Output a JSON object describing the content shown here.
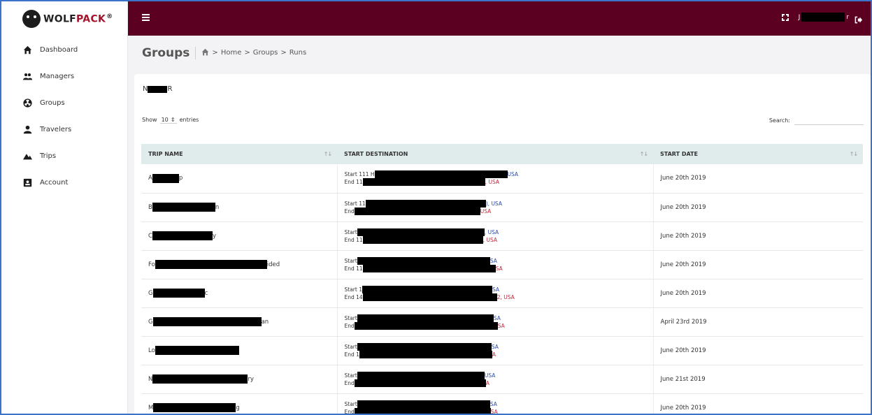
{
  "brand": {
    "name_part1": "WOLF",
    "name_part2": "PACK",
    "registered": "®"
  },
  "sidebar": {
    "items": [
      {
        "label": "Dashboard",
        "icon": "home-icon"
      },
      {
        "label": "Managers",
        "icon": "users-icon"
      },
      {
        "label": "Groups",
        "icon": "radiation-icon"
      },
      {
        "label": "Travelers",
        "icon": "user-icon"
      },
      {
        "label": "Trips",
        "icon": "mountains-icon"
      },
      {
        "label": "Account",
        "icon": "id-card-icon"
      }
    ]
  },
  "topbar": {
    "user_prefix": "J",
    "user_suffix": "r"
  },
  "breadcrumb": {
    "title": "Groups",
    "items": [
      "Home",
      "Groups",
      "Runs"
    ],
    "separator": ">"
  },
  "group": {
    "name_prefix": "N",
    "name_suffix": "R"
  },
  "table_controls": {
    "show_label": "Show",
    "entries_value": "10",
    "entries_label": "entries",
    "search_label": "Search:"
  },
  "table": {
    "headers": [
      "TRIP NAME",
      "START DESTINATION",
      "START DATE"
    ],
    "rows": [
      {
        "name_pre": "A",
        "name_post": "p",
        "start_pre": "Start 111 H",
        "start_post": "USA",
        "end_pre": "End 11",
        "end_post": ", USA",
        "date": "June 20th 2019"
      },
      {
        "name_pre": "B",
        "name_post": "n",
        "start_pre": "Start 11",
        "start_post": "), USA",
        "end_pre": "End",
        "end_post": "USA",
        "date": "June 20th 2019"
      },
      {
        "name_pre": "C",
        "name_post": "y",
        "start_pre": "Start",
        "start_post": ", USA",
        "end_pre": "End 11",
        "end_post": ", USA",
        "date": "June 20th 2019"
      },
      {
        "name_pre": "Fo",
        "name_post": "ided",
        "start_pre": "Start",
        "start_post": "SA",
        "end_pre": "End 11",
        "end_post": "SA",
        "date": "June 20th 2019"
      },
      {
        "name_pre": "G",
        "name_post": "c",
        "start_pre": "Start 1",
        "start_post": "SA",
        "end_pre": "End 14",
        "end_post": "2, USA",
        "date": "June 20th 2019"
      },
      {
        "name_pre": "G",
        "name_post": "an",
        "start_pre": "Start",
        "start_post": "SA",
        "end_pre": "End",
        "end_post": "SA",
        "date": "April 23rd 2019"
      },
      {
        "name_pre": "Lo",
        "name_post": "",
        "start_pre": "Start",
        "start_post": "SA",
        "end_pre": "End 1",
        "end_post": "A",
        "date": "June 20th 2019"
      },
      {
        "name_pre": "N",
        "name_post": "ry",
        "start_pre": "Start",
        "start_post": "USA",
        "end_pre": "End",
        "end_post": "A",
        "date": "June 21st 2019"
      },
      {
        "name_pre": "M",
        "name_post": "g",
        "start_pre": "Start",
        "start_post": "SA",
        "end_pre": "End",
        "end_post": "SA",
        "date": "June 20th 2019"
      }
    ]
  }
}
